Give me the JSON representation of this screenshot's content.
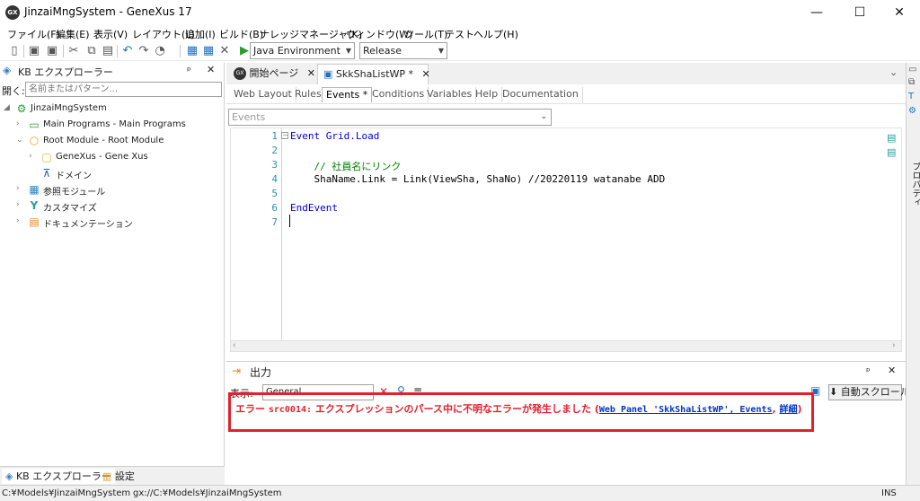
{
  "window": {
    "title": "JinzaiMngSystem - GeneXus 17",
    "logo": "GX",
    "minimize": "—",
    "maximize": "☐",
    "close": "✕"
  },
  "menu": {
    "items": [
      "ファイル(F)",
      "編集(E)",
      "表示(V)",
      "レイアウト(L)",
      "追加(I)",
      "ビルド(B)",
      "ナレッジマネージャ(K)",
      "ウィンドウ(W)",
      "ツール(T)",
      "テスト",
      "ヘルプ(H)"
    ]
  },
  "toolbar": {
    "environment": "Java Environment",
    "configuration": "Release"
  },
  "kb_explorer": {
    "title": "KB エクスプローラー",
    "pin": "ᵖ",
    "close": "✕",
    "open_label": "開く:",
    "search_placeholder": "名前またはパターン...",
    "tree": [
      {
        "label": "JinzaiMngSystem",
        "expander": "◢",
        "icon": "kb-icon",
        "glyph": "⚙"
      },
      {
        "label": "Main Programs - Main Programs",
        "expander": "›",
        "icon": "main-programs-icon",
        "glyph": "▭"
      },
      {
        "label": "Root Module - Root Module",
        "expander": "⌄",
        "icon": "module-icon",
        "glyph": "⬡"
      },
      {
        "label": "GeneXus - Gene Xus",
        "expander": "›",
        "icon": "folder-icon",
        "glyph": "▢"
      },
      {
        "label": "ドメイン",
        "expander": "",
        "icon": "domain-icon",
        "glyph": "⊼"
      },
      {
        "label": "参照モジュール",
        "expander": "›",
        "icon": "references-icon",
        "glyph": "▦"
      },
      {
        "label": "カスタマイズ",
        "expander": "›",
        "icon": "customize-icon",
        "glyph": "Y"
      },
      {
        "label": "ドキュメンテーション",
        "expander": "›",
        "icon": "documentation-icon",
        "glyph": "▤"
      }
    ],
    "bottom_tabs": [
      "KB エクスプローラー",
      "設定"
    ]
  },
  "doc_tabs": [
    {
      "label": "開始ページ",
      "close": "✕"
    },
    {
      "label": "SkkShaListWP *",
      "close": "✕"
    }
  ],
  "sub_tabs": [
    "Web Layout",
    "Rules",
    "Events *",
    "Conditions",
    "Variables",
    "Help",
    "Documentation"
  ],
  "events_combo": "Events",
  "editor": {
    "lines": [
      {
        "num": "1",
        "text": "Event Grid.Load"
      },
      {
        "num": "2",
        "text": ""
      },
      {
        "num": "3",
        "text": "    // 社員名にリンク"
      },
      {
        "num": "4",
        "text": "    ShaName.Link = Link(ViewSha, ShaNo) //20220119 watanabe ADD"
      },
      {
        "num": "5",
        "text": ""
      },
      {
        "num": "6",
        "text": "EndEvent"
      },
      {
        "num": "7",
        "text": ""
      }
    ]
  },
  "output": {
    "title": "出力",
    "pin": "ᵖ",
    "close": "✕",
    "view_label": "表示:",
    "view_value": "General",
    "autoscroll": "自動スクロール",
    "error": {
      "prefix": "エラー",
      "code": "src0014:",
      "message": "エクスプレッションのパース中に不明なエラーが発生しました",
      "open_paren": "(",
      "link": "Web Panel 'SkkShaListWP', Events",
      "comma": ",",
      "detail": "詳細",
      "close_paren": ")"
    }
  },
  "right_strip": {
    "label": "プロパティ"
  },
  "status": {
    "path": "C:¥Models¥JinzaiMngSystem",
    "gx_path": "gx://C:¥Models¥JinzaiMngSystem",
    "mode": "INS"
  }
}
